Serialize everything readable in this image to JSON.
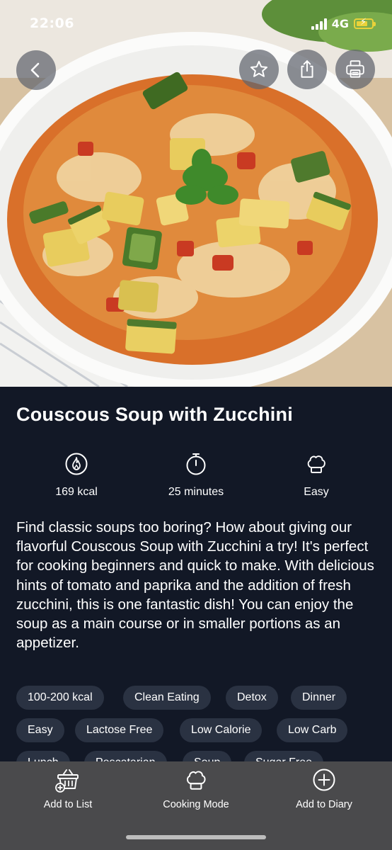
{
  "status_bar": {
    "time": "22:06",
    "network": "4G",
    "battery_color": "#e8d23a"
  },
  "hero": {
    "back_icon": "chevron-left-icon",
    "favorite_icon": "star-icon",
    "share_icon": "share-icon",
    "print_icon": "printer-icon"
  },
  "recipe": {
    "title": "Couscous Soup with Zucchini",
    "stats": {
      "calories": "169 kcal",
      "duration": "25 minutes",
      "difficulty": "Easy"
    },
    "description": "Find classic soups too boring? How about giving our flavorful Couscous Soup with Zucchini a try! It's perfect for cooking beginners and quick to make. With delicious hints of tomato and paprika and the addition of fresh zucchini, this is one fantastic dish! You can enjoy the soup as a main course or in smaller portions as an appetizer.",
    "tags": [
      "100-200 kcal",
      "Clean Eating",
      "Detox",
      "Dinner",
      "Easy",
      "Lactose Free",
      "Low Calorie",
      "Low Carb",
      "Lunch",
      "Pescatarian",
      "Soup",
      "Sugar Free"
    ]
  },
  "bottom_bar": {
    "add_to_list": "Add to List",
    "cooking_mode": "Cooking Mode",
    "add_to_diary": "Add to Diary"
  },
  "colors": {
    "background": "#121826",
    "tag_background": "#2a3242",
    "bottom_bar": "#4a4a4c"
  }
}
